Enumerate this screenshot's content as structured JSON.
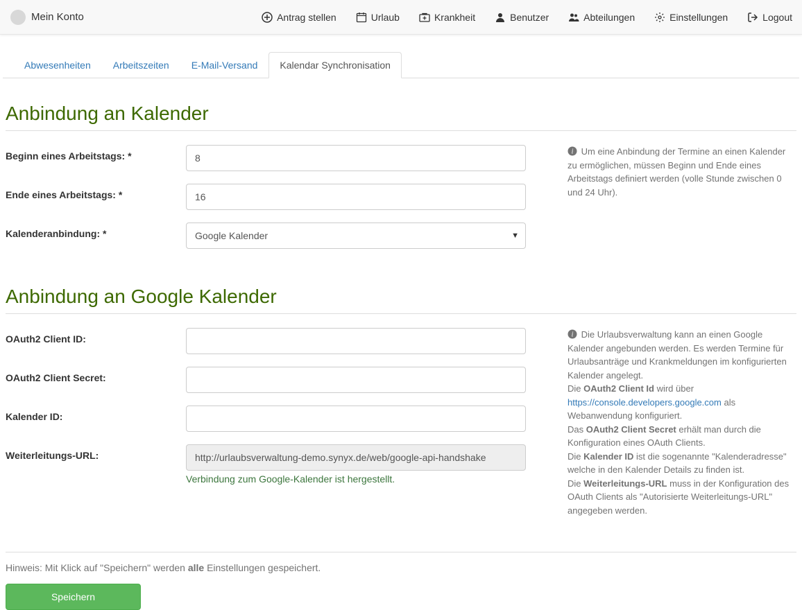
{
  "navbar": {
    "brand": "Mein Konto",
    "items": [
      {
        "icon": "plus-circle",
        "label": "Antrag stellen"
      },
      {
        "icon": "calendar",
        "label": "Urlaub"
      },
      {
        "icon": "medkit",
        "label": "Krankheit"
      },
      {
        "icon": "user",
        "label": "Benutzer"
      },
      {
        "icon": "users",
        "label": "Abteilungen"
      },
      {
        "icon": "cog",
        "label": "Einstellungen"
      },
      {
        "icon": "sign-out",
        "label": "Logout"
      }
    ]
  },
  "tabs": {
    "items": [
      "Abwesenheiten",
      "Arbeitszeiten",
      "E-Mail-Versand",
      "Kalendar Synchronisation"
    ],
    "active": 3
  },
  "section1": {
    "title": "Anbindung an Kalender",
    "workday_start": {
      "label": "Beginn eines Arbeitstags: *",
      "value": "8"
    },
    "workday_end": {
      "label": "Ende eines Arbeitstags: *",
      "value": "16"
    },
    "calendar_binding": {
      "label": "Kalenderanbindung: *",
      "value": "Google Kalender"
    },
    "help": "Um eine Anbindung der Termine an einen Kalender zu ermöglichen, müssen Beginn und Ende eines Arbeitstags definiert werden (volle Stunde zwischen 0 und 24 Uhr)."
  },
  "section2": {
    "title": "Anbindung an Google Kalender",
    "client_id": {
      "label": "OAuth2 Client ID:",
      "value": ""
    },
    "client_secret": {
      "label": "OAuth2 Client Secret:",
      "value": ""
    },
    "calendar_id": {
      "label": "Kalender ID:",
      "value": ""
    },
    "redirect_url": {
      "label": "Weiterleitungs-URL:",
      "value": "http://urlaubsverwaltung-demo.synyx.de/web/google-api-handshake"
    },
    "status": "Verbindung zum Google-Kalender ist hergestellt.",
    "help": {
      "intro": "Die Urlaubsverwaltung kann an einen Google Kalender angebunden werden. Es werden Termine für Urlaubsanträge und Krankmeldungen im konfigurierten Kalender angelegt.",
      "p1a": "Die ",
      "p1b": "OAuth2 Client Id",
      "p1c": " wird über ",
      "p1link": "https://console.developers.google.com",
      "p1d": " als Webanwendung konfiguriert.",
      "p2a": "Das ",
      "p2b": "OAuth2 Client Secret",
      "p2c": " erhält man durch die Konfiguration eines OAuth Clients.",
      "p3a": "Die ",
      "p3b": "Kalender ID",
      "p3c": " ist die sogenannte \"Kalenderadresse\" welche in den Kalender Details zu finden ist.",
      "p4a": "Die ",
      "p4b": "Weiterleitungs-URL",
      "p4c": " muss in der Konfiguration des OAuth Clients als \"Autorisierte Weiterleitungs-URL\" angegeben werden."
    }
  },
  "footer": {
    "note_pre": "Hinweis: Mit Klick auf \"Speichern\" werden ",
    "note_bold": "alle",
    "note_post": " Einstellungen gespeichert.",
    "save": "Speichern"
  }
}
